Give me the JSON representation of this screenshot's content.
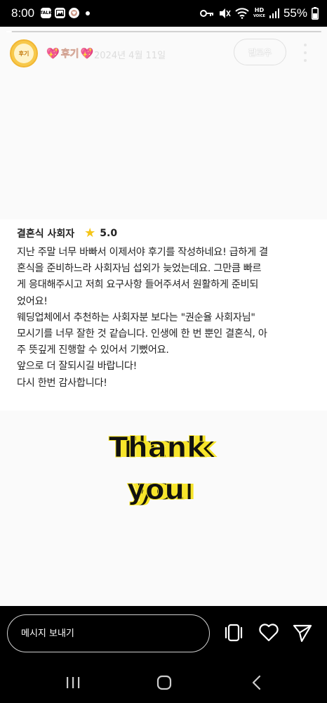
{
  "status_bar": {
    "time": "8:00",
    "battery": "55%",
    "chip_talk": "TALK",
    "hd_label": "HD",
    "hd_sub": "VOICE"
  },
  "story": {
    "avatar_label": "후기",
    "username": "후기",
    "date": "2024년 4월 11일",
    "follow_label": "팔로우",
    "progress": 0.02
  },
  "review": {
    "title": "결혼식 사회자",
    "rating": "5.0",
    "body": "지난 주말 너무 바빠서 이제서야 후기를 작성하네요! 급하게 결\n혼식을 준비하느라 사회자님 섭외가 늦었는데요. 그만큼 빠르\n게 응대해주시고 저희 요구사항 들어주셔서 원활하게 준비되\n었어요!\n웨딩업체에서 추천하는 사회자분 보다는 \"권순율 사회자님\"\n모시기를 너무 잘한 것 같습니다. 인생에 한 번 뿐인 결혼식, 아\n주 뜻깊게 진행할 수 있어서 기뻤어요.\n앞으로 더 잘되시길 바랍니다!\n다시 한번 감사합니다!"
  },
  "sticker": {
    "line1": "Thank",
    "line2": "you"
  },
  "bottom_bar": {
    "message_placeholder": "메시지 보내기"
  },
  "colors": {
    "accent_star": "#f5c518",
    "sticker_yellow": "#f7e52a",
    "username_heart": "#f27fc0"
  },
  "icons": [
    "key-icon",
    "mute-icon",
    "wifi-icon",
    "signal-icon",
    "more-icon",
    "star-icon",
    "reshare-icon",
    "heart-icon",
    "send-icon",
    "recents-icon",
    "home-icon",
    "back-icon"
  ]
}
